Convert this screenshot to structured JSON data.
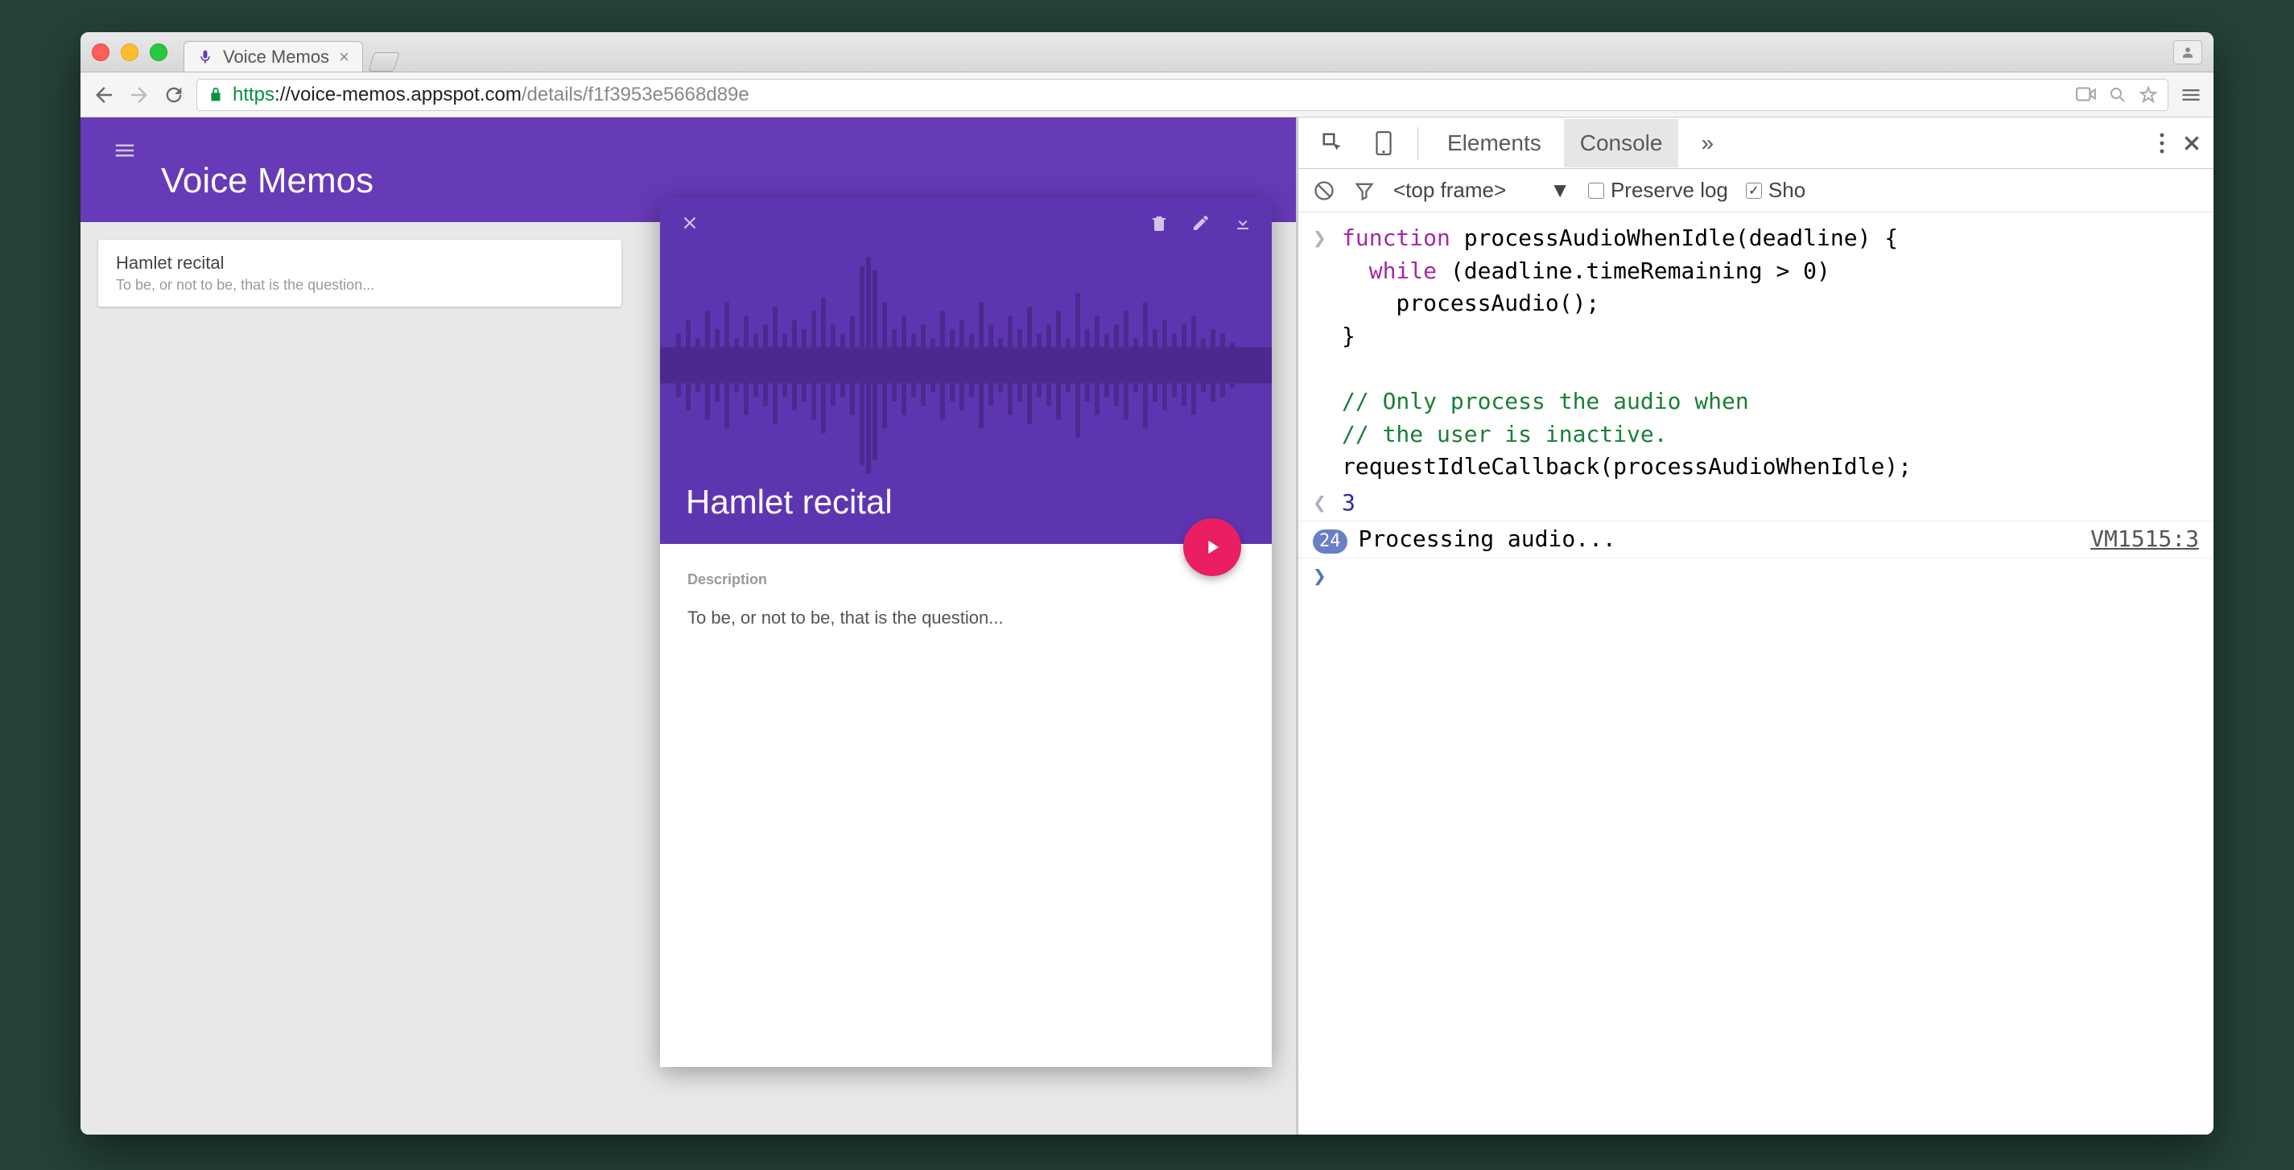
{
  "window": {
    "tab_title": "Voice Memos"
  },
  "nav": {
    "scheme": "https",
    "host": "://voice-memos.appspot.com",
    "path": "/details/f1f3953e5668d89e"
  },
  "app": {
    "title": "Voice Memos",
    "list": [
      {
        "title": "Hamlet recital",
        "subtitle": "To be, or not to be, that is the question..."
      }
    ],
    "detail": {
      "title": "Hamlet recital",
      "description_label": "Description",
      "description": "To be, or not to be, that is the question..."
    }
  },
  "devtools": {
    "tabs": {
      "elements": "Elements",
      "console": "Console",
      "more": "»"
    },
    "toolbar": {
      "frame": "<top frame>",
      "preserve_log": "Preserve log",
      "show": "Sho"
    },
    "code": {
      "l1": "function processAudioWhenIdle(deadline) {",
      "l1_kw": "function",
      "l1_rest": " processAudioWhenIdle(deadline) {",
      "l2_kw": "while",
      "l2_rest": " (deadline.timeRemaining > 0)",
      "l3": "    processAudio();",
      "l4": "}",
      "l5": "// Only process the audio when",
      "l6": "// the user is inactive.",
      "l7": "requestIdleCallback(processAudioWhenIdle);"
    },
    "return_value": "3",
    "log": {
      "count": "24",
      "message": "Processing audio...",
      "source": "VM1515:3"
    }
  }
}
